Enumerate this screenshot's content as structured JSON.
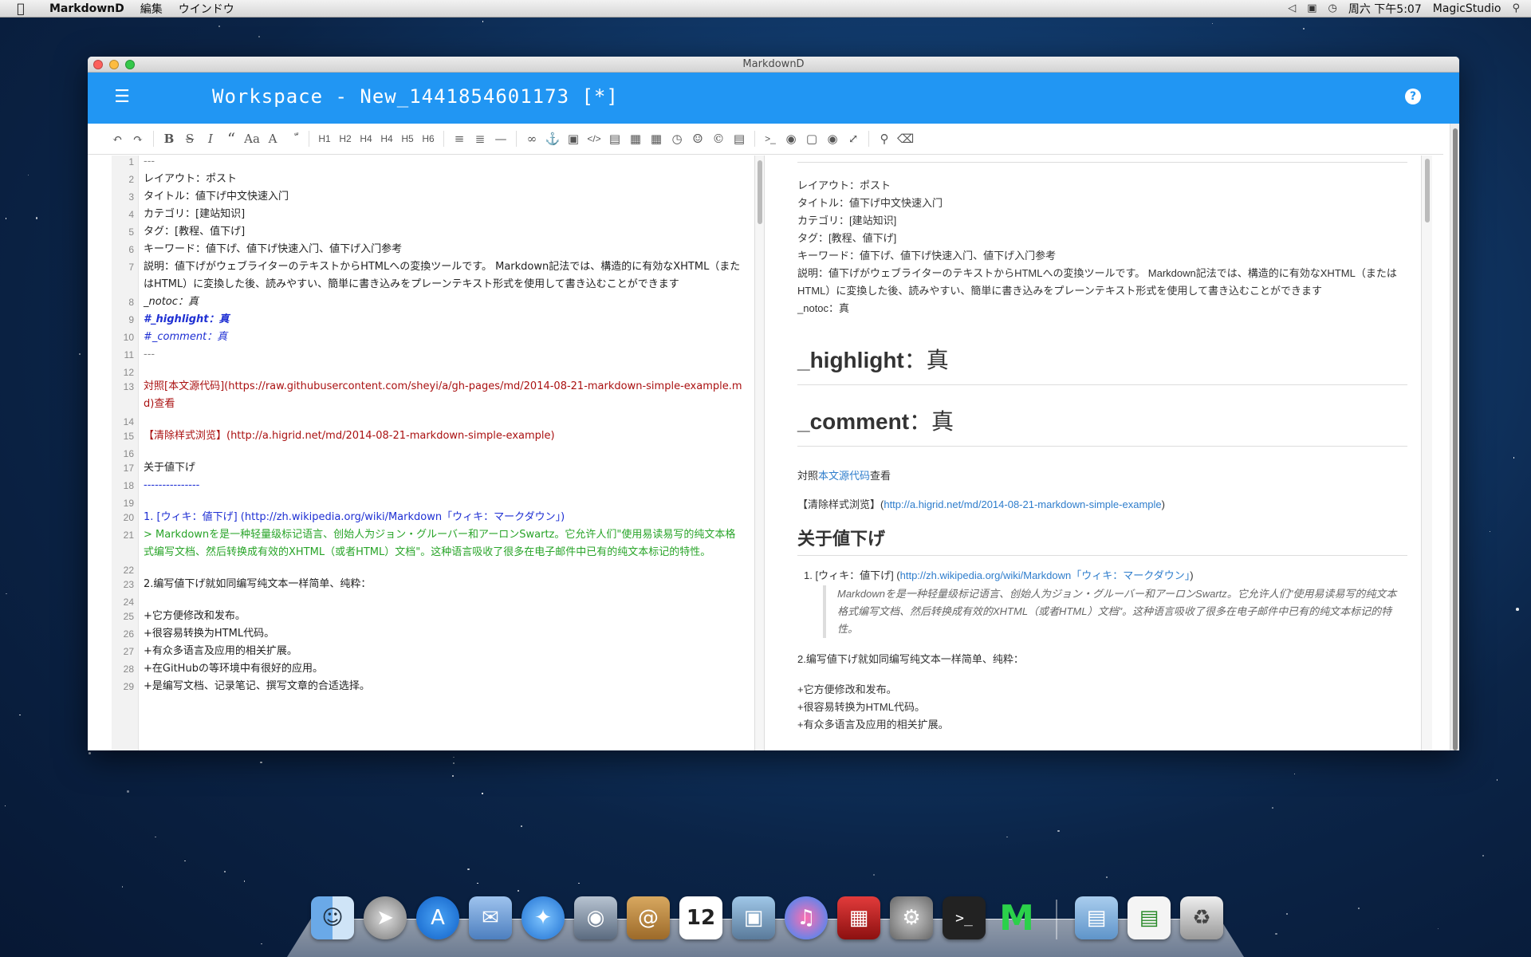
{
  "menubar": {
    "app_name": "MarkdownD",
    "menus": [
      "編集",
      "ウインドウ"
    ],
    "clock": "周六 下午5:07",
    "user": "MagicStudio"
  },
  "window": {
    "title": "MarkdownD",
    "app_title": "Workspace - New_1441854601173 [*]",
    "help_label": "?"
  },
  "toolbar": {
    "icons": [
      "undo-icon",
      "redo-icon",
      "bold-icon",
      "strikethrough-icon",
      "italic-icon",
      "quote-icon",
      "font-size-icon",
      "font-icon",
      "circle-icon",
      "h1",
      "h2",
      "h3",
      "h4",
      "h5",
      "h6",
      "list-ul-icon",
      "list-ol-icon",
      "hr-icon",
      "link-icon",
      "anchor-icon",
      "image-icon",
      "code-icon",
      "code-block-icon",
      "file-icon",
      "table-icon",
      "clock-icon",
      "emoji-icon",
      "html-entity-icon",
      "page-icon",
      "terminal-icon",
      "preview-off-icon",
      "desktop-icon",
      "watch-icon",
      "fullscreen-icon",
      "search-icon",
      "clear-icon"
    ],
    "headings": [
      "H1",
      "H2",
      "H4",
      "H4",
      "H5",
      "H6"
    ]
  },
  "editor": {
    "lines": [
      {
        "n": "1",
        "t": "---"
      },
      {
        "n": "2",
        "t": "レイアウト：ポスト"
      },
      {
        "n": "3",
        "t": "タイトル：値下げ中文快速入门"
      },
      {
        "n": "4",
        "t": "カテゴリ：[建站知识]"
      },
      {
        "n": "5",
        "t": "タグ：[教程、值下げ]"
      },
      {
        "n": "6",
        "t": "キーワード：値下げ、値下げ快速入门、値下げ入门参考"
      },
      {
        "n": "7",
        "t": "説明：値下げがウェブライターのテキストからHTMLへの変換ツールです。 Markdown記法では、構造的に有効なXHTML（またはHTML）に変換した後、読みやすい、簡単に書き込みをプレーンテキスト形式を使用して書き込むことができます"
      },
      {
        "n": "8",
        "t": "_notoc：真"
      },
      {
        "n": "9",
        "t": "#_highlight：真"
      },
      {
        "n": "10",
        "t": "#_comment：真"
      },
      {
        "n": "11",
        "t": "---"
      },
      {
        "n": "12",
        "t": ""
      },
      {
        "n": "13",
        "t": "対照[本文源代码](https://raw.githubusercontent.com/sheyi/a/gh-pages/md/2014-08-21-markdown-simple-example.md)查看"
      },
      {
        "n": "14",
        "t": ""
      },
      {
        "n": "15",
        "t": "【清除样式浏览】(http://a.higrid.net/md/2014-08-21-markdown-simple-example)"
      },
      {
        "n": "16",
        "t": ""
      },
      {
        "n": "17",
        "t": "关于値下げ"
      },
      {
        "n": "18",
        "t": "---------------"
      },
      {
        "n": "19",
        "t": ""
      },
      {
        "n": "20",
        "t": "1. [ウィキ：値下げ] (http://zh.wikipedia.org/wiki/Markdown「ウィキ：マークダウン」)"
      },
      {
        "n": "21",
        "t": "> Markdownを是一种轻量级标记语言、创始人为ジョン・グルーバー和アーロンSwartz。它允许人们\"使用易读易写的纯文本格式编写文档、然后转换成有效的XHTML（或者HTML）文档\"。这种语言吸收了很多在电子邮件中已有的纯文本标记的特性。"
      },
      {
        "n": "22",
        "t": ""
      },
      {
        "n": "23",
        "t": "2.编写値下げ就如同编写纯文本一样简单、纯粋："
      },
      {
        "n": "24",
        "t": ""
      },
      {
        "n": "25",
        "t": "+它方便修改和发布。"
      },
      {
        "n": "26",
        "t": "+很容易转换为HTML代码。"
      },
      {
        "n": "27",
        "t": "+有众多语言及应用的相关扩展。"
      },
      {
        "n": "28",
        "t": "+在GitHubの等环境中有很好的应用。"
      },
      {
        "n": "29",
        "t": "+是编写文档、记录笔记、撰写文章的合适选择。"
      }
    ]
  },
  "preview": {
    "meta": [
      "レイアウト：ポスト",
      "タイトル：値下げ中文快速入门",
      "カテゴリ：[建站知识]",
      "タグ：[教程、値下げ]",
      "キーワード：値下げ、値下げ快速入门、値下げ入门参考",
      "説明：値下げがウェブライターのテキストからHTMLへの変換ツールです。 Markdown記法では、構造的に有効なXHTML（またはHTML）に変換した後、読みやすい、簡単に書き込みをプレーンテキスト形式を使用して書き込むことができます",
      "_notoc：真"
    ],
    "h_highlight": "_highlight",
    "h_highlight_val": "：真",
    "h_comment": "_comment",
    "h_comment_val": "：真",
    "p_compare_prefix": "対照",
    "p_compare_link": "本文源代码",
    "p_compare_suffix": "查看",
    "p_clear_prefix": "【清除样式浏览】(",
    "p_clear_link": "http://a.higrid.net/md/2014-08-21-markdown-simple-example",
    "p_clear_suffix": ")",
    "h2": "关于値下げ",
    "li1_prefix": "1.  [ウィキ：値下げ] (",
    "li1_link": "http://zh.wikipedia.org/wiki/Markdown「ウィキ：マークダウン」",
    "li1_suffix": ")",
    "blockquote": "Markdownを是一种轻量级标记语言、创始人为ジョン・グルーバー和アーロンSwartz。它允许人们\"使用易读易写的纯文本格式编写文档、然后转换成有效的XHTML（或者HTML）文档\"。这种语言吸收了很多在电子邮件中已有的纯文本标记的特性。",
    "p2": "2.编写値下げ就如同编写纯文本一样简单、纯粋：",
    "p3a": "+它方便修改和发布。",
    "p3b": "+很容易转换为HTML代码。",
    "p3c": "+有众多语言及应用的相关扩展。"
  },
  "dock": {
    "apps": [
      "finder-icon",
      "launchpad-icon",
      "app-store-icon",
      "mail-icon",
      "safari-icon",
      "facetime-icon",
      "contacts-icon",
      "calendar-icon",
      "photos-icon",
      "itunes-icon",
      "photobooth-icon",
      "system-preferences-icon",
      "terminal-icon",
      "markdownd-icon",
      "folder-icon",
      "document-icon",
      "trash-icon"
    ],
    "calendar_day": "12"
  }
}
